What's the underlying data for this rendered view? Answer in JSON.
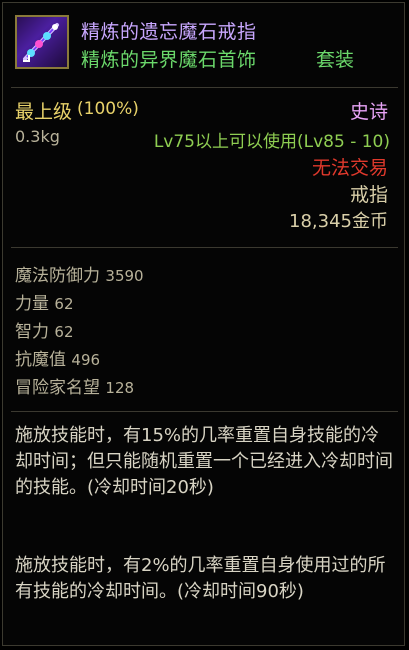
{
  "item": {
    "name": "精炼的遗忘魔石戒指",
    "set_name": "精炼的异界魔石首饰",
    "set_tag": "套装",
    "icon": "ring-item-icon",
    "grade": "最上级",
    "grade_pct": "(100%)",
    "rarity": "史诗",
    "weight": "0.3kg",
    "level_req": "Lv75以上可以使用(Lv85 - 10)",
    "trade": "无法交易",
    "slot": "戒指",
    "price": "18,345金币"
  },
  "stats": [
    {
      "label": "魔法防御力",
      "value": "3590"
    },
    {
      "label": "力量",
      "value": "62"
    },
    {
      "label": "智力",
      "value": "62"
    },
    {
      "label": "抗魔值",
      "value": "496"
    },
    {
      "label": "冒险家名望",
      "value": "128"
    }
  ],
  "descriptions": [
    "施放技能时，有15%的几率重置自身技能的冷却时间；但只能随机重置一个已经进入冷却时间的技能。(冷却时间20秒)",
    "施放技能时，有2%的几率重置自身使用过的所有技能的冷却时间。(冷却时间90秒)"
  ],
  "colors": {
    "name": "#c9a8ff",
    "set": "#6bd86b",
    "grade": "#e8d26a",
    "rarity": "#e8a4f6",
    "level": "#8fce52",
    "trade": "#e0392c"
  }
}
